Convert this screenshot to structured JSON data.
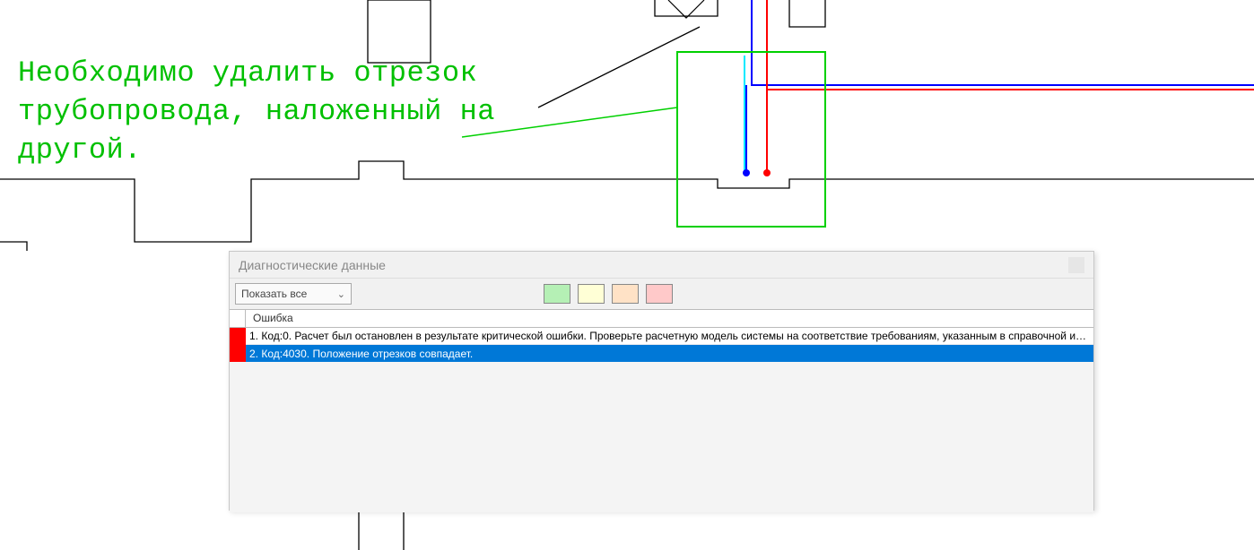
{
  "annotation": {
    "line1": "Необходимо удалить отрезок",
    "line2": "трубопровода, наложенный на",
    "line3": "другой."
  },
  "panel": {
    "title": "Диагностические данные",
    "filter_label": "Показать все",
    "header": "Ошибка",
    "rows": [
      {
        "flag": "red",
        "selected": false,
        "text": "1. Код:0. Расчет был остановлен в результате критической ошибки. Проверьте расчетную модель системы на соответствие требованиям, указанным в справочной информации."
      },
      {
        "flag": "red",
        "selected": true,
        "text": "2. Код:4030. Положение отрезков совпадает."
      }
    ]
  }
}
